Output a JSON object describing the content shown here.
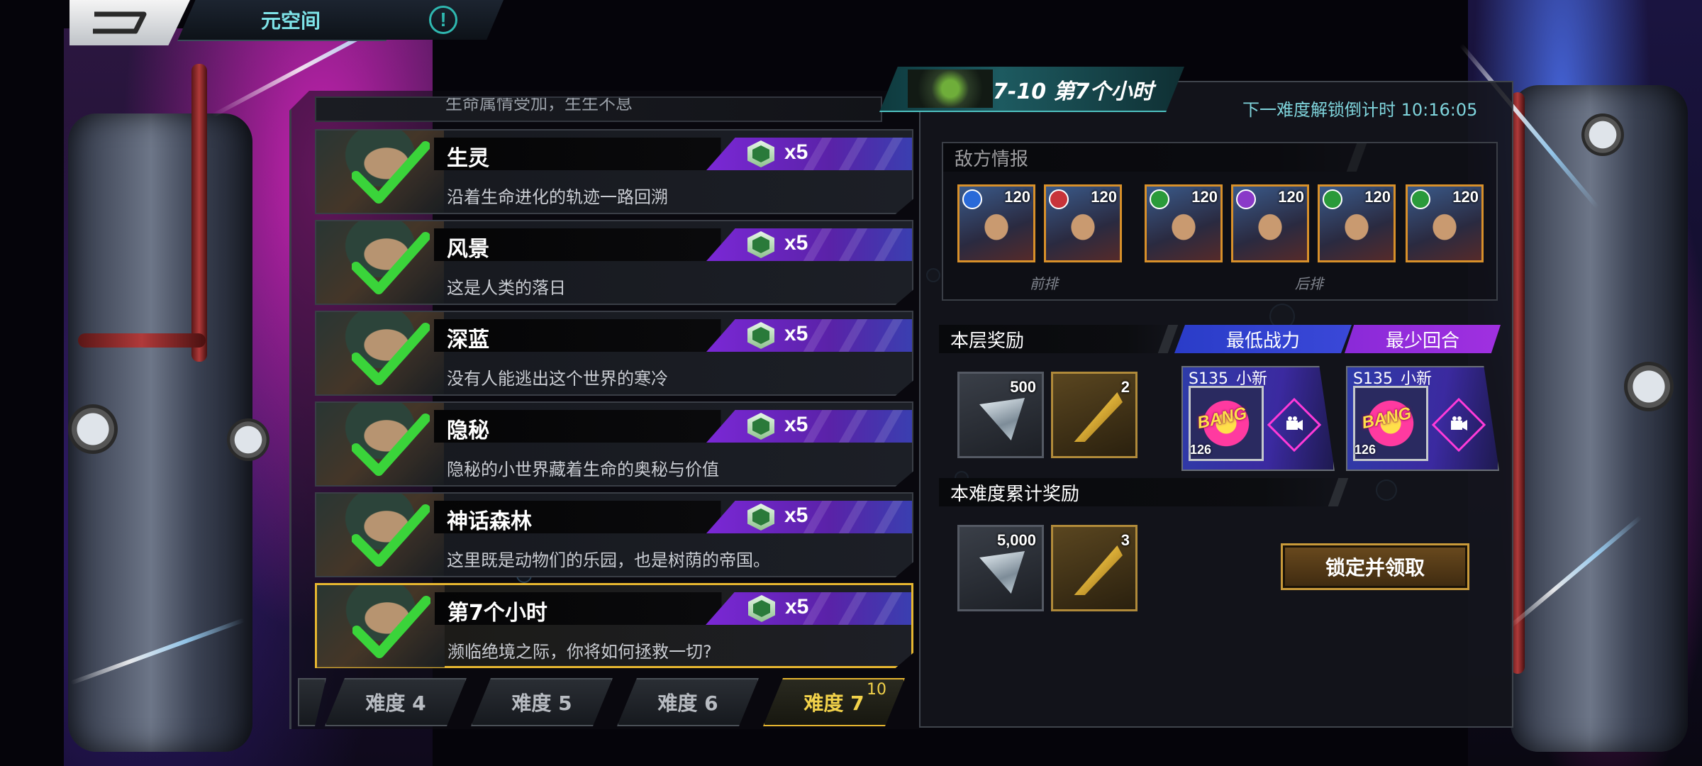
{
  "header": {
    "title": "元空间",
    "info_icon": "!"
  },
  "stages": {
    "previous_partial_desc": "生命属情受加，生生不息",
    "items": [
      {
        "name": "生灵",
        "desc": "沿着生命进化的轨迹一路回溯",
        "reward_multiplier": "x5",
        "completed": true
      },
      {
        "name": "风景",
        "desc": "这是人类的落日",
        "reward_multiplier": "x5",
        "completed": true
      },
      {
        "name": "深蓝",
        "desc": "没有人能逃出这个世界的寒冷",
        "reward_multiplier": "x5",
        "completed": true
      },
      {
        "name": "隐秘",
        "desc": "隐秘的小世界藏着生命的奥秘与价值",
        "reward_multiplier": "x5",
        "completed": true
      },
      {
        "name": "神话森林",
        "desc": "这里既是动物们的乐园，也是树荫的帝国。",
        "reward_multiplier": "x5",
        "completed": true
      },
      {
        "name": "第7个小时",
        "desc": "濒临绝境之际，你将如何拯救一切?",
        "reward_multiplier": "x5",
        "completed": true,
        "selected": true
      }
    ]
  },
  "difficulty_tabs": [
    {
      "label": "难度 4"
    },
    {
      "label": "难度 5"
    },
    {
      "label": "难度 6"
    },
    {
      "label": "难度 7",
      "count": "10",
      "active": true
    }
  ],
  "detail": {
    "stage_title": "7-10 第7个小时",
    "countdown": "下一难度解锁倒计时 10:16:05",
    "enemy_section": "敌方情报",
    "front_row_label": "前排",
    "back_row_label": "后排",
    "enemies": [
      {
        "level": "120",
        "element": "blue"
      },
      {
        "level": "120",
        "element": "red"
      },
      {
        "level": "120",
        "element": "green"
      },
      {
        "level": "120",
        "element": "purple"
      },
      {
        "level": "120",
        "element": "green"
      },
      {
        "level": "120",
        "element": "green"
      }
    ],
    "floor_reward_section": "本层奖励",
    "min_power_label": "最低战力",
    "min_rounds_label": "最少回合",
    "floor_rewards": [
      {
        "icon": "crystal-icon",
        "qty": "500"
      },
      {
        "icon": "gold-feather-icon",
        "qty": "2"
      }
    ],
    "records": [
      {
        "player": "S135_小新",
        "level": "126",
        "badge": "BANG"
      },
      {
        "player": "S135_小新",
        "level": "126",
        "badge": "BANG"
      }
    ],
    "cumulative_section": "本难度累计奖励",
    "cumulative_rewards": [
      {
        "icon": "crystal-icon",
        "qty": "5,000"
      },
      {
        "icon": "gold-feather-icon",
        "qty": "3"
      }
    ],
    "claim_button": "锁定并领取"
  },
  "colors": {
    "accent_gold": "#e6b630",
    "reward_purple": "#7b28d6",
    "title_cyan": "#7ee3e8"
  }
}
